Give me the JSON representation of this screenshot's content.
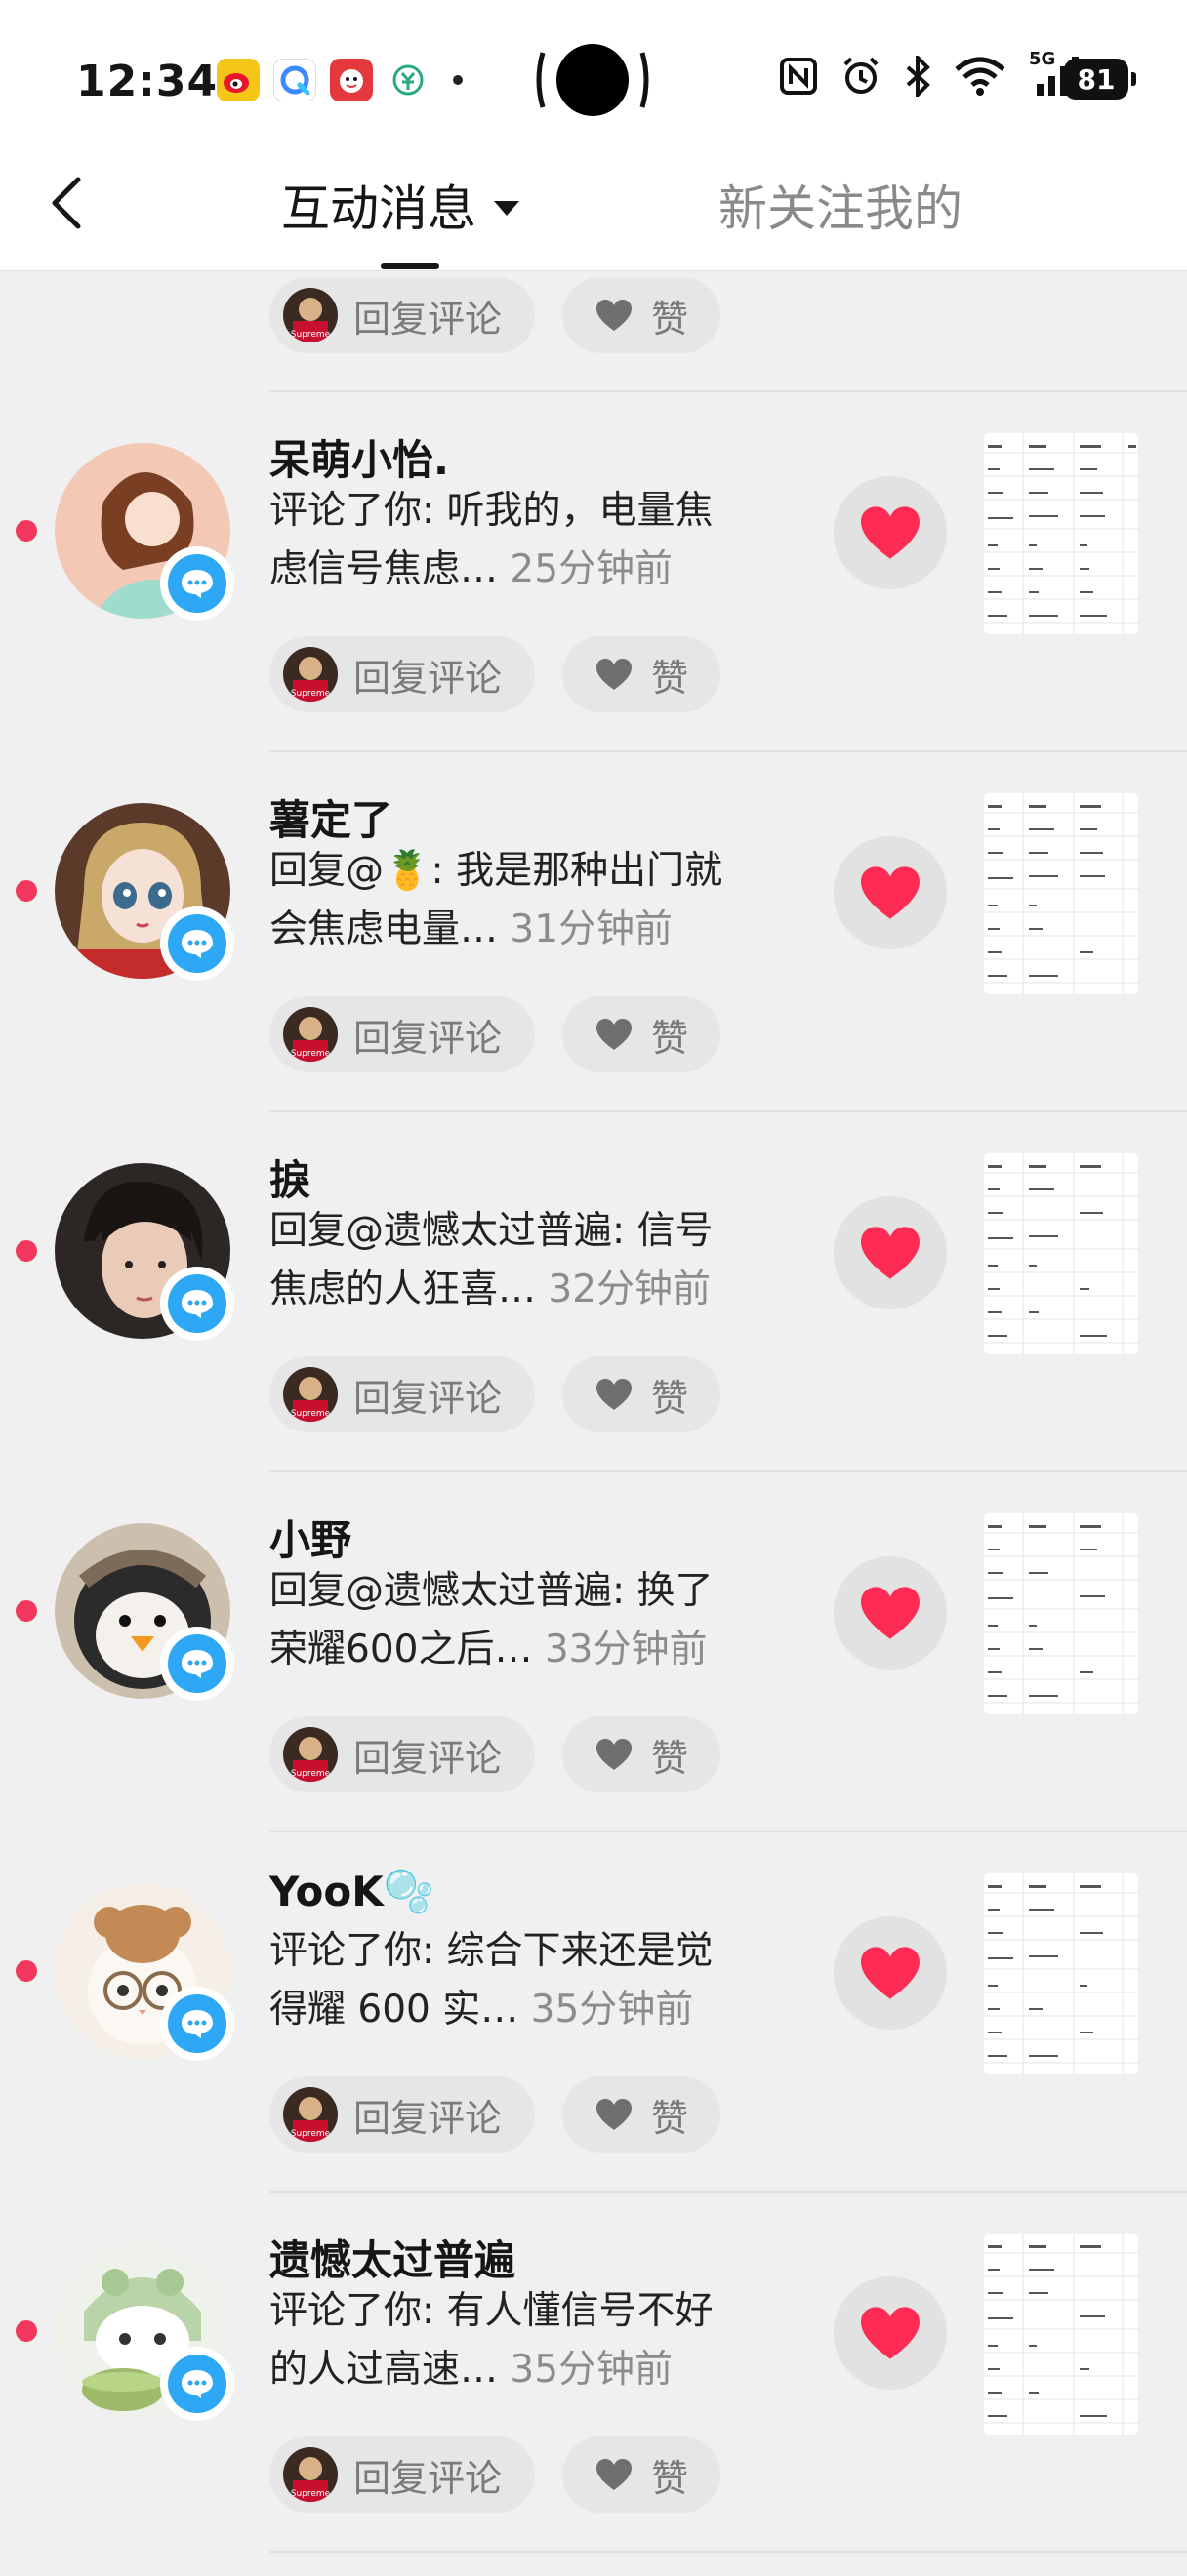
{
  "status_bar": {
    "time": "12:34",
    "battery": "81",
    "app_icons": [
      "weibo-icon",
      "quark-browser-icon",
      "app-618-icon",
      "digital-rmb-icon"
    ],
    "system_icons": [
      "nfc-icon",
      "alarm-icon",
      "bluetooth-icon",
      "wifi-icon",
      "5g-signal-icon"
    ],
    "network_label": "5G"
  },
  "header": {
    "tab_active": "互动消息",
    "tab_inactive": "新关注我的"
  },
  "top_partial": {
    "reply_label": "回复评论",
    "like_label": "赞"
  },
  "messages": [
    {
      "name": "呆萌小怡.",
      "text": "评论了你: 听我的，电量焦虑信号焦虑…",
      "line1": "评论了你: 听我的，电量焦",
      "line2": "虑信号焦虑…",
      "time": "25分钟前",
      "reply_label": "回复评论",
      "like_label": "赞"
    },
    {
      "name": "薯定了",
      "line1": "回复@🍍: 我是那种出门就",
      "line2": "会焦虑电量…",
      "time": "31分钟前",
      "reply_label": "回复评论",
      "like_label": "赞"
    },
    {
      "name": "捩",
      "line1": "回复@遗憾太过普遍: 信号",
      "line2": "焦虑的人狂喜…",
      "time": "32分钟前",
      "reply_label": "回复评论",
      "like_label": "赞"
    },
    {
      "name": "小野",
      "line1": "回复@遗憾太过普遍: 换了",
      "line2": "荣耀600之后…",
      "time": "33分钟前",
      "reply_label": "回复评论",
      "like_label": "赞"
    },
    {
      "name": "YooK🫧",
      "line1": "评论了你: 综合下来还是觉",
      "line2": "得耀 600 实…",
      "time": "35分钟前",
      "reply_label": "回复评论",
      "like_label": "赞"
    },
    {
      "name": "遗憾太过普遍",
      "line1": "评论了你: 有人懂信号不好",
      "line2": "的人过高速…",
      "time": "35分钟前",
      "reply_label": "回复评论",
      "like_label": "赞"
    }
  ],
  "colors": {
    "unread_dot": "#f2385f",
    "badge": "#2ea7f5",
    "heart": "#fe2c55"
  }
}
